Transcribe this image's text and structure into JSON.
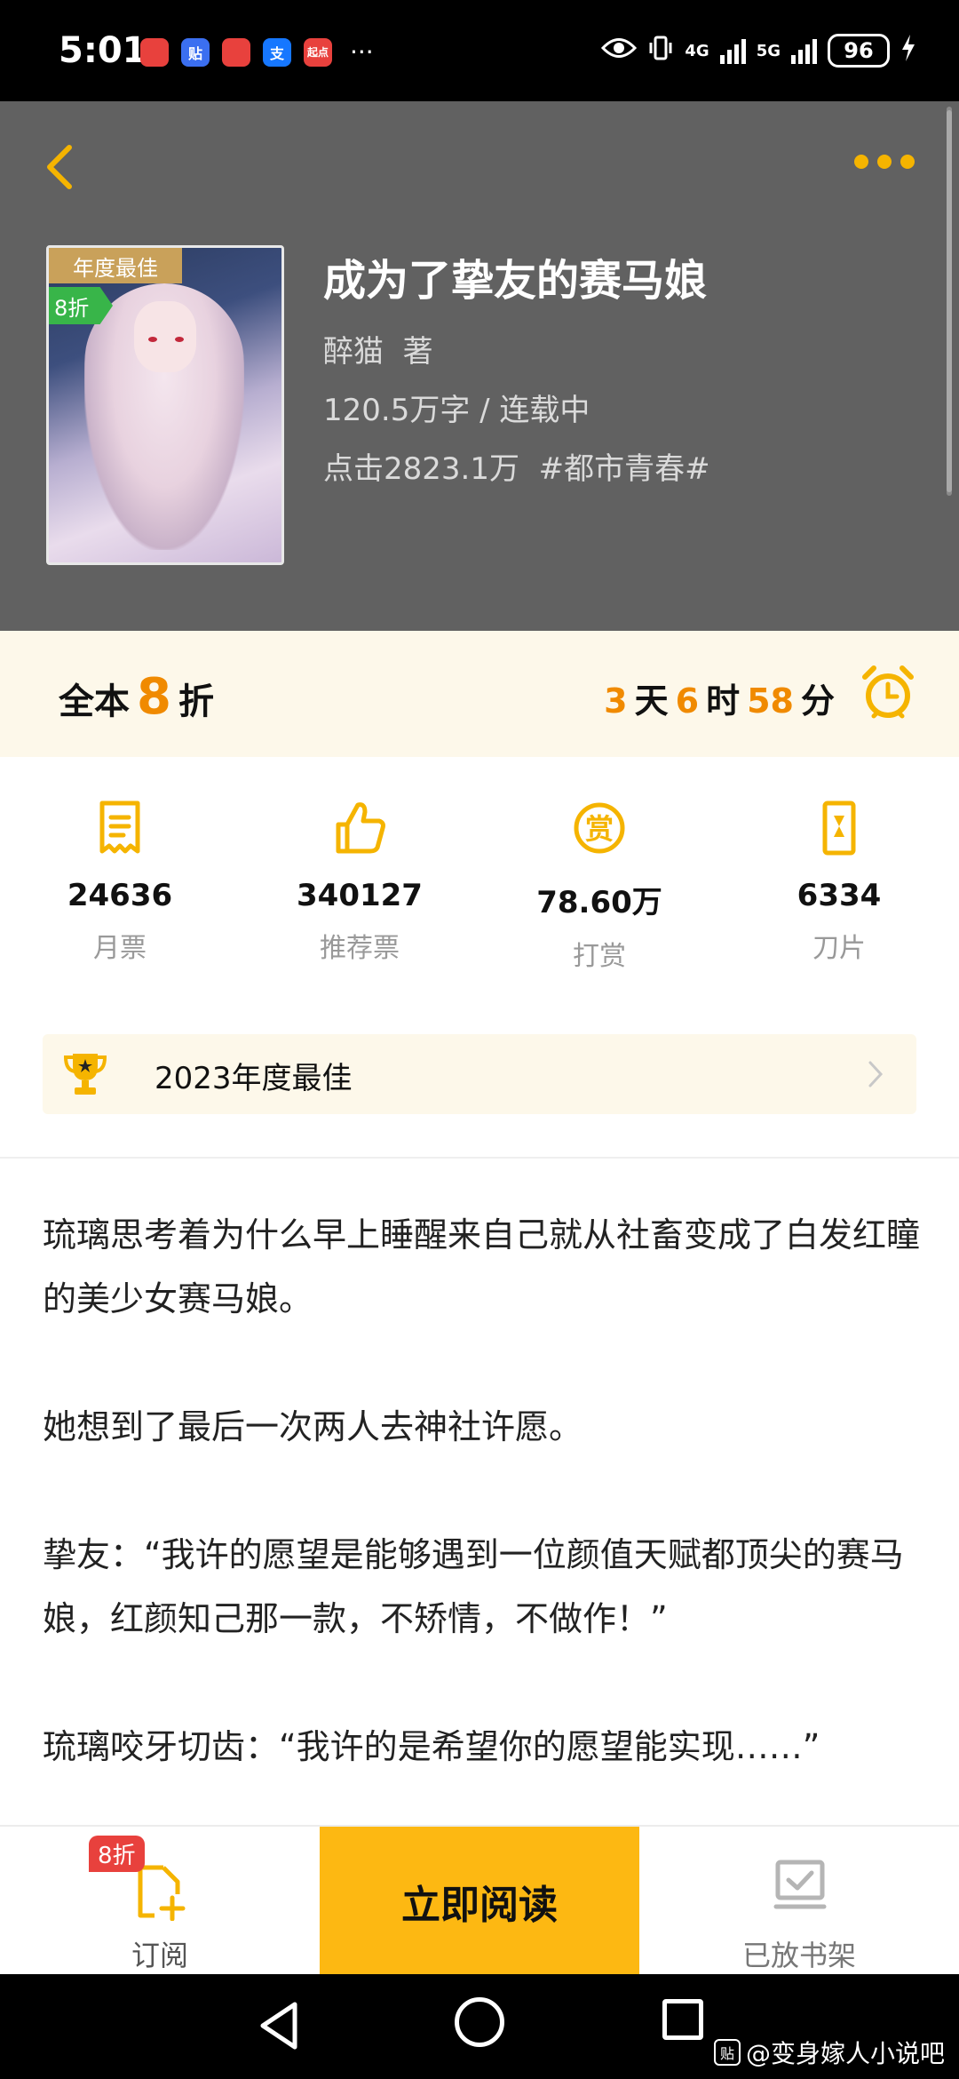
{
  "status_bar": {
    "time": "5:01",
    "apps": [
      {
        "icon": "huawei-video-icon",
        "label": "",
        "color": "#e8413d"
      },
      {
        "icon": "tieba-icon",
        "label": "贴",
        "color": "#3b6ff0"
      },
      {
        "icon": "huawei-appgallery-icon",
        "label": "",
        "color": "#e8413d"
      },
      {
        "icon": "alipay-icon",
        "label": "支",
        "color": "#1677ff"
      },
      {
        "icon": "qidian-icon",
        "label": "起点",
        "color": "#e8413d"
      }
    ],
    "more": "···",
    "signal_1": "4G",
    "signal_2": "5G",
    "battery": "96"
  },
  "header": {
    "cover_badge_year": "年度最佳",
    "cover_badge_discount": "8折",
    "title": "成为了挚友的赛马娘",
    "author": "醉猫  著",
    "words_status": "120.5万字 / 连载中",
    "clicks_tag": "点击2823.1万  #都市青春#"
  },
  "discount": {
    "prefix": "全本",
    "number": "8",
    "suffix": "折",
    "days": "3",
    "days_unit": "天",
    "hours": "6",
    "hours_unit": "时",
    "minutes": "58",
    "minutes_unit": "分"
  },
  "stats": [
    {
      "icon": "monthly-ticket-icon",
      "value": "24636",
      "label": "月票"
    },
    {
      "icon": "thumbs-up-icon",
      "value": "340127",
      "label": "推荐票"
    },
    {
      "icon": "reward-icon",
      "value": "78.60万",
      "label": "打赏"
    },
    {
      "icon": "blade-icon",
      "value": "6334",
      "label": "刀片"
    }
  ],
  "award": {
    "text": "2023年度最佳"
  },
  "synopsis": [
    "琉璃思考着为什么早上睡醒来自己就从社畜变成了白发红瞳的美少女赛马娘。",
    "她想到了最后一次两人去神社许愿。",
    "挚友：“我许的愿望是能够遇到一位颜值天赋都顶尖的赛马娘，红颜知己那一款，不矫情，不做作！”",
    "琉璃咬牙切齿：“我许的是希望你的愿望能实现……”"
  ],
  "action_bar": {
    "subscribe_badge": "8折",
    "subscribe_label": "订阅",
    "read_label": "立即阅读",
    "shelf_label": "已放书架"
  },
  "watermark": {
    "logo": "贴",
    "text": "@变身嫁人小说吧"
  },
  "colors": {
    "accent": "#fdb812",
    "orange": "#f08a00",
    "header_bg": "#616161",
    "icon_gold": "#f5b400"
  }
}
